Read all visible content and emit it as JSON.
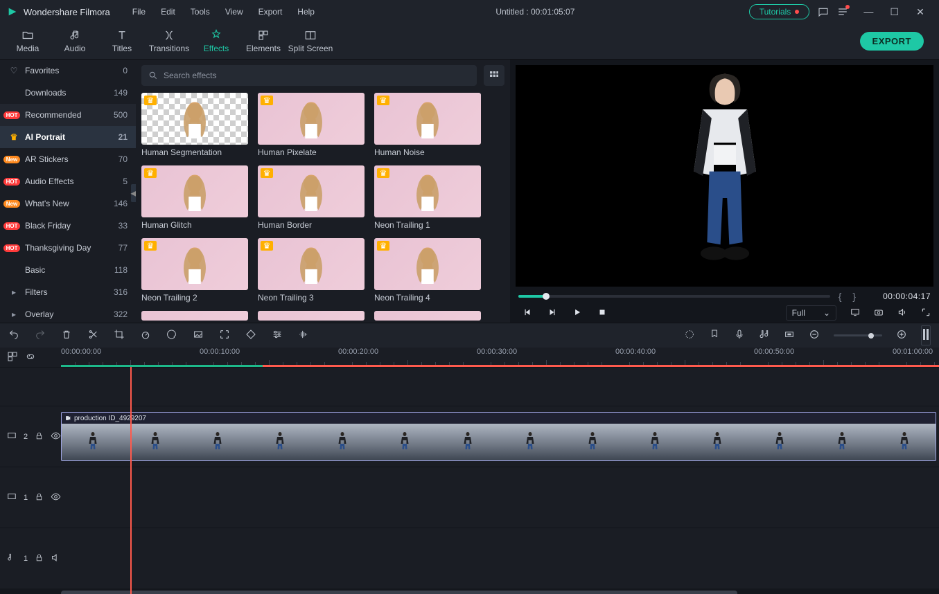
{
  "app": {
    "title": "Wondershare Filmora",
    "project_label": "Untitled : 00:01:05:07"
  },
  "menus": [
    "File",
    "Edit",
    "Tools",
    "View",
    "Export",
    "Help"
  ],
  "titlebar_buttons": {
    "tutorials": "Tutorials"
  },
  "tabs": [
    {
      "id": "media",
      "label": "Media"
    },
    {
      "id": "audio",
      "label": "Audio"
    },
    {
      "id": "titles",
      "label": "Titles"
    },
    {
      "id": "transitions",
      "label": "Transitions"
    },
    {
      "id": "effects",
      "label": "Effects",
      "active": true
    },
    {
      "id": "elements",
      "label": "Elements"
    },
    {
      "id": "splitscreen",
      "label": "Split Screen"
    }
  ],
  "export_label": "EXPORT",
  "search": {
    "placeholder": "Search effects"
  },
  "categories": [
    {
      "label": "Favorites",
      "count": "0",
      "icon": "heart"
    },
    {
      "label": "Downloads",
      "count": "149"
    },
    {
      "label": "Recommended",
      "count": "500",
      "badge": "HOT",
      "dim": true
    },
    {
      "label": "AI Portrait",
      "count": "21",
      "icon": "crown",
      "selected": true
    },
    {
      "label": "AR Stickers",
      "count": "70",
      "badge": "New"
    },
    {
      "label": "Audio Effects",
      "count": "5",
      "badge": "HOT"
    },
    {
      "label": "What's New",
      "count": "146",
      "badge": "New"
    },
    {
      "label": "Black Friday",
      "count": "33",
      "badge": "HOT"
    },
    {
      "label": "Thanksgiving Day",
      "count": "77",
      "badge": "HOT"
    },
    {
      "label": "Basic",
      "count": "118"
    },
    {
      "label": "Filters",
      "count": "316",
      "expand": true
    },
    {
      "label": "Overlay",
      "count": "322",
      "expand": true
    }
  ],
  "effects": [
    {
      "label": "Human Segmentation",
      "checker": true
    },
    {
      "label": "Human Pixelate"
    },
    {
      "label": "Human Noise"
    },
    {
      "label": "Human Glitch"
    },
    {
      "label": "Human Border"
    },
    {
      "label": "Neon Trailing 1"
    },
    {
      "label": "Neon Trailing 2"
    },
    {
      "label": "Neon Trailing 3"
    },
    {
      "label": "Neon Trailing 4"
    }
  ],
  "preview": {
    "timecode": "00:00:04:17",
    "quality_label": "Full"
  },
  "ruler_marks": [
    "00:00:00:00",
    "00:00:10:00",
    "00:00:20:00",
    "00:00:30:00",
    "00:00:40:00",
    "00:00:50:00",
    "00:01:00:00"
  ],
  "tracks": {
    "video2": {
      "label": "2",
      "clip_name": "production ID_4929207"
    },
    "video1": {
      "label": "1"
    },
    "audio1": {
      "label": "1"
    }
  },
  "colors": {
    "accent": "#1ec8a5"
  }
}
